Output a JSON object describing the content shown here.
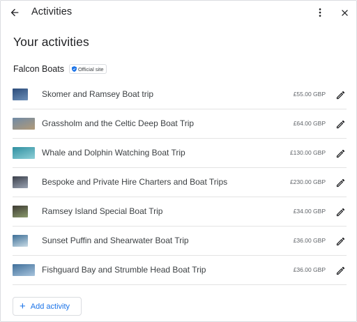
{
  "header": {
    "title": "Activities",
    "back_icon": "arrow-back-icon",
    "more_icon": "more-vert-icon",
    "close_icon": "close-icon"
  },
  "page": {
    "heading": "Your activities"
  },
  "business": {
    "name": "Falcon Boats",
    "badge_label": "Official site",
    "badge_icon": "shield-icon",
    "badge_color": "#1a73e8"
  },
  "activities": [
    {
      "title": "Skomer and Ramsey Boat trip",
      "price": "£55.00 GBP",
      "thumb": [
        "#2b4b7a",
        "#6c8fb8"
      ]
    },
    {
      "title": "Grassholm and the Celtic Deep Boat Trip",
      "price": "£64.00 GBP",
      "thumb": [
        "#6f8aa6",
        "#b29a78"
      ]
    },
    {
      "title": "Whale and Dolphin Watching Boat Trip",
      "price": "£130.00 GBP",
      "thumb": [
        "#2f8fa0",
        "#8fd0d8"
      ]
    },
    {
      "title": "Bespoke and Private Hire Charters and Boat Trips",
      "price": "£230.00 GBP",
      "thumb": [
        "#3a3f4a",
        "#9aa3b2"
      ]
    },
    {
      "title": "Ramsey Island Special Boat Trip",
      "price": "£34.00 GBP",
      "thumb": [
        "#3d3a33",
        "#8a9a6c"
      ]
    },
    {
      "title": "Sunset Puffin and Shearwater Boat Trip",
      "price": "£36.00 GBP",
      "thumb": [
        "#3c6e96",
        "#c9dbe6"
      ]
    },
    {
      "title": "Fishguard Bay and Strumble Head Boat Trip",
      "price": "£36.00 GBP",
      "thumb": [
        "#3f6f9a",
        "#a8c4dd"
      ]
    }
  ],
  "edit_icon": "pencil-icon",
  "add_button": {
    "label": "Add activity",
    "icon": "plus-icon",
    "color": "#1a73e8"
  }
}
